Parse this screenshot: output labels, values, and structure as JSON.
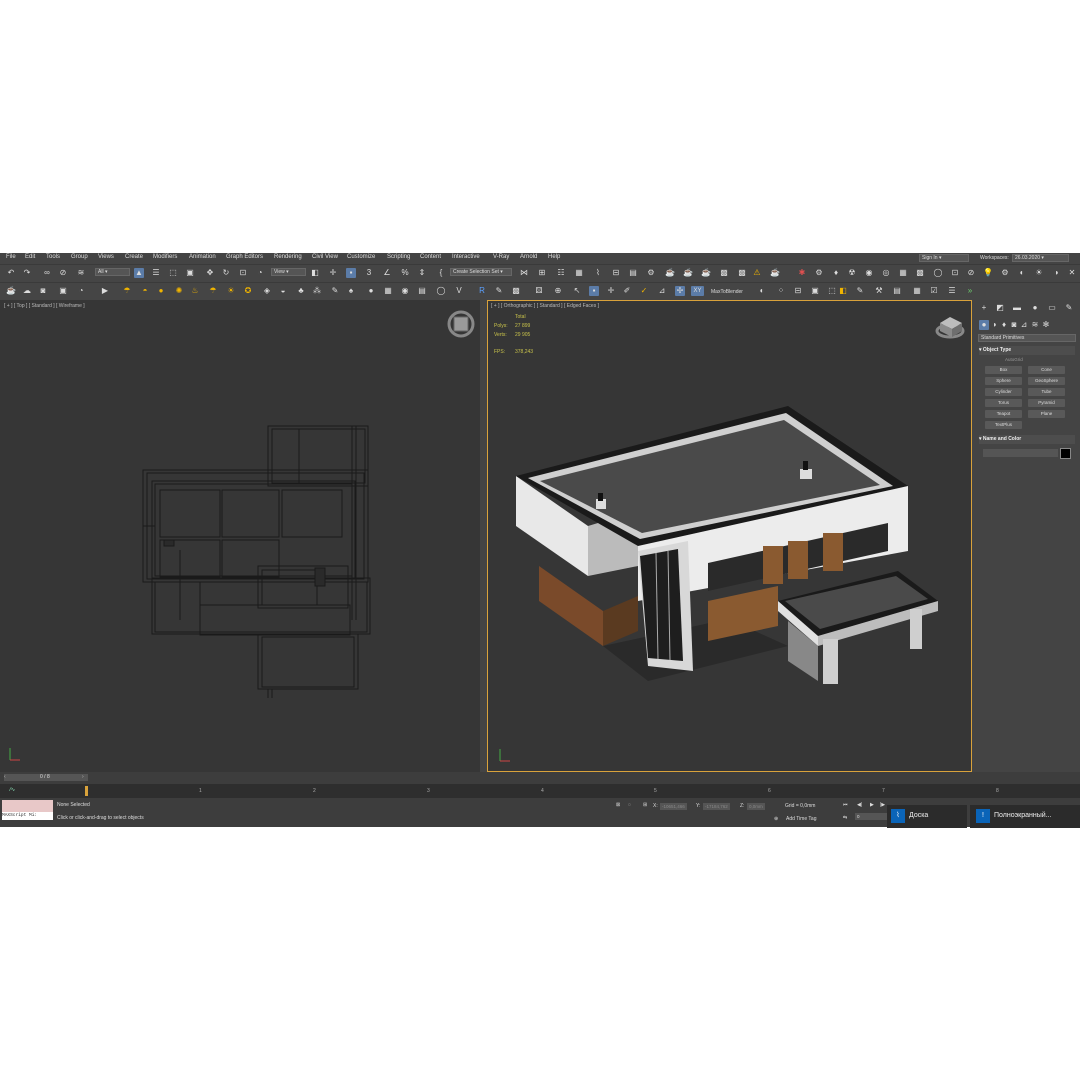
{
  "menu": [
    "File",
    "Edit",
    "Tools",
    "Group",
    "Views",
    "Create",
    "Modifiers",
    "Animation",
    "Graph Editors",
    "Rendering",
    "Civil View",
    "Customize",
    "Scripting",
    "Content",
    "Interactive",
    "V-Ray",
    "Arnold",
    "Help"
  ],
  "signin": "Sign In",
  "workspaces_label": "Workspaces:",
  "workspaces_value": "26.03.2020",
  "toolbar": {
    "filter_value": "All",
    "refcoord_value": "View",
    "selection_set": "Create Selection Set",
    "max_to_blender": "MaxToBlender",
    "xy_label": "XY"
  },
  "viewport_left": {
    "label": "[ + ] [ Top ] [ Standard ] [ Wireframe ]"
  },
  "viewport_right": {
    "label": "[ + ] [ Orthographic ] [ Standard ] [ Edged Faces ]",
    "total_label": "Total",
    "polys_label": "Polys:",
    "polys_value": "27 899",
    "verts_label": "Verts:",
    "verts_value": "29 905",
    "fps_label": "FPS:",
    "fps_value": "378,243"
  },
  "panel": {
    "dropdown": "Standard Primitives",
    "object_type": "Object Type",
    "autogrid": "AutoGrid",
    "buttons": [
      "Box",
      "Cone",
      "Sphere",
      "GeoSphere",
      "Cylinder",
      "Tube",
      "Torus",
      "Pyramid",
      "Teapot",
      "Plane",
      "TextPlus"
    ],
    "name_and_color": "Name and Color",
    "color": "#000000"
  },
  "timeline": {
    "frame_counter": "0 / 8",
    "ticks": [
      "1",
      "2",
      "3",
      "4",
      "5",
      "6",
      "7",
      "8"
    ],
    "maxscript": "MAXScript Mi:",
    "status": "None Selected",
    "prompt": "Click or click-and-drag to select objects",
    "x_label": "X:",
    "x_value": "-10651,466",
    "y_label": "Y:",
    "y_value": "-17184,762",
    "z_label": "Z:",
    "z_value": "0,0mm",
    "grid": "Grid = 0,0mm",
    "add_time_tag": "Add Time Tag",
    "frame_value": "0"
  },
  "taskbar": {
    "board_label": "Доска",
    "fullscreen_label": "Полноэкранный..."
  },
  "colors": {
    "accent": "#d9a23b",
    "selection_blue": "#5b7ca8",
    "stats": "#c9c34b"
  }
}
